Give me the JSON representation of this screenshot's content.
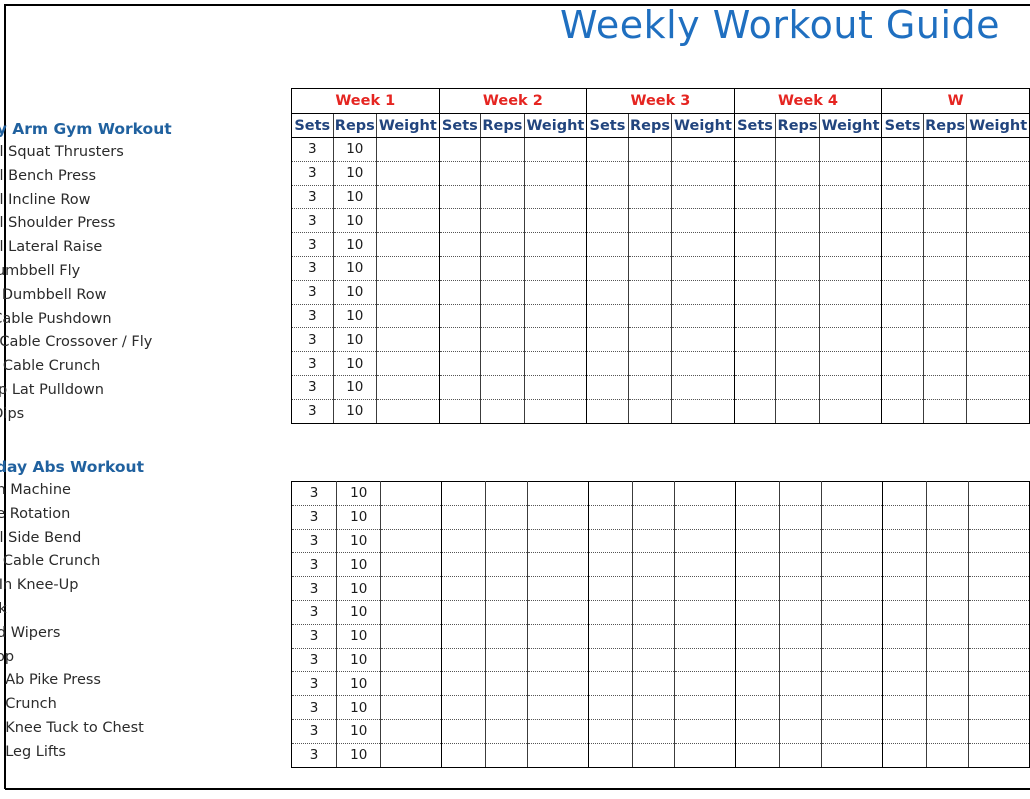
{
  "document": {
    "title": "Weekly Workout Guide",
    "title_color": "#1f6fc0",
    "view_state": "horizontally scrolled right; left edge of exercise-name column and right edge of week 5 are clipped"
  },
  "colors": {
    "title_blue": "#1f6fc0",
    "section_heading_blue": "#20619f",
    "week_label_red": "#e52521",
    "column_header_navy": "#22457e",
    "grid_line": "#3c3c3c",
    "grid_border": "#000000",
    "body_text": "#2b2b2b"
  },
  "week_columns": [
    "Sets",
    "Reps",
    "Weight"
  ],
  "weeks": [
    {
      "label": "Week 1",
      "partial": false
    },
    {
      "label": "Week 2",
      "partial": false
    },
    {
      "label": "Week 3",
      "partial": false
    },
    {
      "label": "Week 4",
      "partial": false
    },
    {
      "label": "W",
      "partial": true
    }
  ],
  "sections": [
    {
      "heading": "onday Arm Gym Workout",
      "heading_full": "Monday Arm Gym Workout",
      "exercises": [
        {
          "name": "mbbell Squat Thrusters",
          "name_full": "Dumbbell Squat Thrusters",
          "sets": "3",
          "reps": "10",
          "weight": ""
        },
        {
          "name": "mbbell Bench Press",
          "name_full": "Dumbbell Bench Press",
          "sets": "3",
          "reps": "10",
          "weight": ""
        },
        {
          "name": "mbbell Incline Row",
          "name_full": "Dumbbell Incline Row",
          "sets": "3",
          "reps": "10",
          "weight": ""
        },
        {
          "name": "mbbell Shoulder Press",
          "name_full": "Dumbbell Shoulder Press",
          "sets": "3",
          "reps": "10",
          "weight": ""
        },
        {
          "name": "mbbell Lateral Raise",
          "name_full": "Dumbbell Lateral Raise",
          "sets": "3",
          "reps": "10",
          "weight": ""
        },
        {
          "name": "line Dumbbell Fly",
          "name_full": "Incline Dumbbell Fly",
          "sets": "3",
          "reps": "10",
          "weight": ""
        },
        {
          "name": "e Arm Dumbbell Row",
          "name_full": "One Arm Dumbbell Row",
          "sets": "3",
          "reps": "10",
          "weight": ""
        },
        {
          "name": "ceps Cable Pushdown",
          "name_full": "Triceps Cable Pushdown",
          "sets": "3",
          "reps": "10",
          "weight": ""
        },
        {
          "name": "nding Cable Crossover / Fly",
          "name_full": "Standing Cable Crossover / Fly",
          "sets": "3",
          "reps": "10",
          "weight": ""
        },
        {
          "name": "eeling Cable Crunch",
          "name_full": "Kneeling Cable Crunch",
          "sets": "3",
          "reps": "10",
          "weight": ""
        },
        {
          "name": "de-Gap Lat Pulldown",
          "name_full": "Wide-Gap Lat Pulldown",
          "sets": "3",
          "reps": "10",
          "weight": ""
        },
        {
          "name": "ceps Dips",
          "name_full": "Triceps Dips",
          "sets": "3",
          "reps": "10",
          "weight": ""
        }
      ]
    },
    {
      "heading": "dnesday Abs Workout",
      "heading_full": "Wednesday Abs Workout",
      "exercises": [
        {
          "name": "Crunch Machine",
          "name_full": "Ab Crunch Machine",
          "sets": "3",
          "reps": "10",
          "weight": ""
        },
        {
          "name": "le Core Rotation",
          "name_full": "Cable Core Rotation",
          "sets": "3",
          "reps": "10",
          "weight": ""
        },
        {
          "name": "mbbell Side Bend",
          "name_full": "Dumbbell Side Bend",
          "sets": "3",
          "reps": "10",
          "weight": ""
        },
        {
          "name": "eeling Cable Crunch",
          "name_full": "Kneeling Cable Crunch",
          "sets": "3",
          "reps": "10",
          "weight": ""
        },
        {
          "name": "g Pull-In Knee-Up",
          "name_full": "Hanging Pull-In Knee-Up",
          "sets": "3",
          "reps": "10",
          "weight": ""
        },
        {
          "name": "e Plank",
          "name_full": "Side Plank",
          "sets": "3",
          "reps": "10",
          "weight": ""
        },
        {
          "name": "dshield Wipers",
          "name_full": "Windshield Wipers",
          "sets": "3",
          "reps": "10",
          "weight": ""
        },
        {
          "name": "od Chop",
          "name_full": "Wood Chop",
          "sets": "3",
          "reps": "10",
          "weight": ""
        },
        {
          "name": "ss Ball Ab Pike Press",
          "name_full": "Swiss Ball Ab Pike Press",
          "sets": "3",
          "reps": "10",
          "weight": ""
        },
        {
          "name": "ss Ball Crunch",
          "name_full": "Swiss Ball Crunch",
          "sets": "3",
          "reps": "10",
          "weight": ""
        },
        {
          "name": "ss Ball Knee Tuck to Chest",
          "name_full": "Swiss Ball Knee Tuck to Chest",
          "sets": "3",
          "reps": "10",
          "weight": ""
        },
        {
          "name": "ss Ball Leg Lifts",
          "name_full": "Swiss Ball Leg Lifts",
          "sets": "3",
          "reps": "10",
          "weight": ""
        }
      ]
    }
  ]
}
